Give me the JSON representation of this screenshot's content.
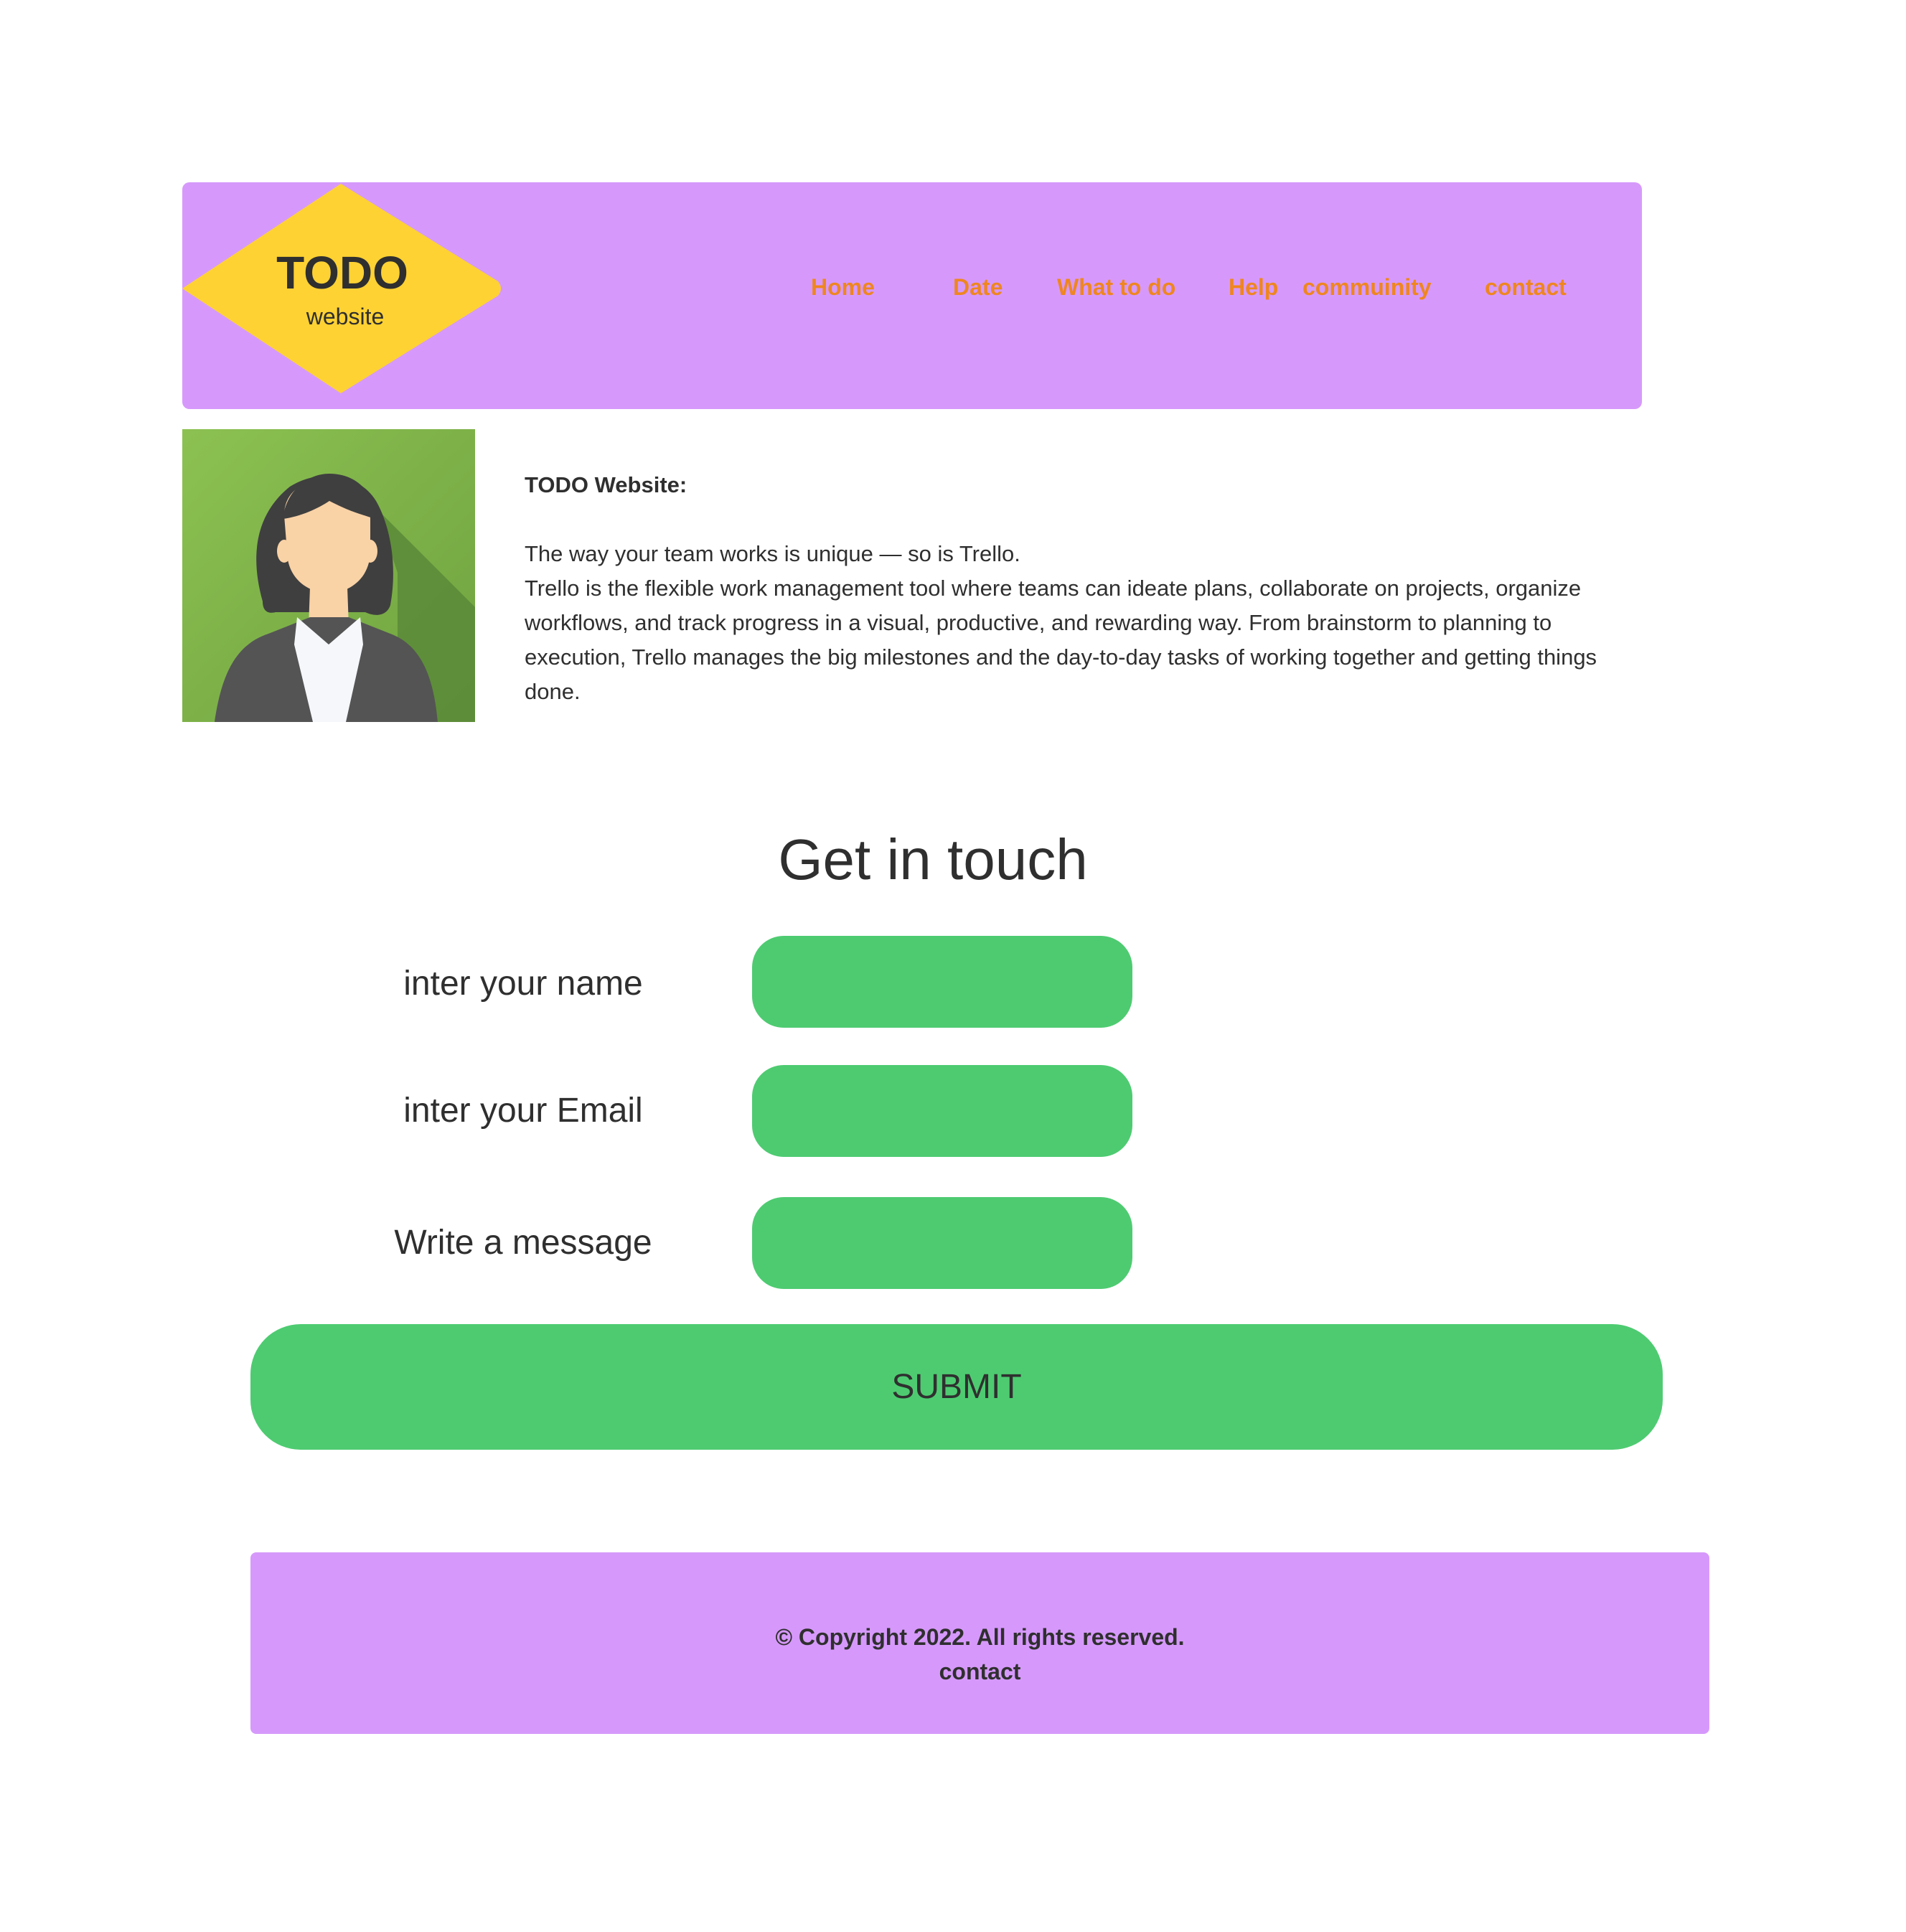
{
  "colors": {
    "header_bg": "#d699fb",
    "logo_bg": "#ffd233",
    "nav_text": "#ef861f",
    "text": "#2f2f2f",
    "button_green": "#4ecb71",
    "footer_bg": "#d699fb"
  },
  "header": {
    "logo": {
      "title": "TODO",
      "subtitle": "website"
    },
    "nav": [
      {
        "label": "Home"
      },
      {
        "label": "Date"
      },
      {
        "label": "What to do"
      },
      {
        "label": "Help"
      },
      {
        "label": "commuinity"
      },
      {
        "label": "contact"
      }
    ]
  },
  "about": {
    "avatar_icon": "businesswoman-avatar-icon",
    "title": "TODO Website:",
    "paragraph_1": "The way your team works is unique — so is Trello.",
    "paragraph_2": "Trello is the flexible work management tool where teams can ideate plans, collaborate on projects, organize workflows, and track progress in a visual, productive, and rewarding way. From brainstorm to planning to execution, Trello manages the big milestones and the day-to-day tasks of working together and getting things done."
  },
  "contact_form": {
    "heading": "Get in touch",
    "fields": [
      {
        "label": "inter your name",
        "value": "",
        "placeholder": ""
      },
      {
        "label": "inter your Email",
        "value": "",
        "placeholder": ""
      },
      {
        "label": "Write a message",
        "value": "",
        "placeholder": ""
      }
    ],
    "submit_label": "SUBMIT"
  },
  "footer": {
    "copyright": "© Copyright 2022. All rights reserved.",
    "contact_label": "contact"
  }
}
